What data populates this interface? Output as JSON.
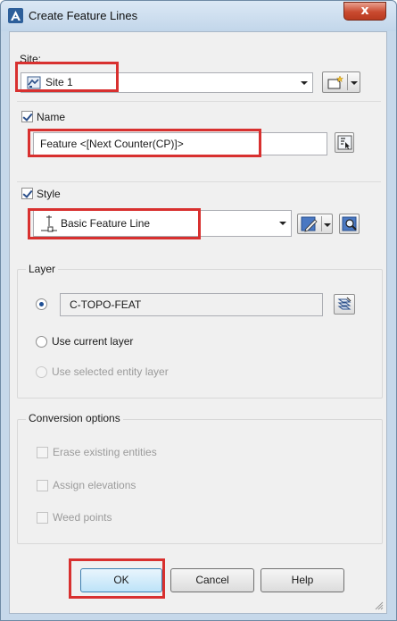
{
  "window": {
    "title": "Create Feature Lines",
    "close_glyph": "x",
    "app_icon": "autocad-a-icon",
    "accent": "#d8302f"
  },
  "site": {
    "label": "Site:",
    "value": "Site 1",
    "icon": "site-icon",
    "create_icon": "create-new-site-icon"
  },
  "name": {
    "label": "Name",
    "checked": true,
    "value": "Feature <[Next Counter(CP)]>",
    "edit_icon": "name-format-icon"
  },
  "style": {
    "label": "Style",
    "checked": true,
    "value": "Basic Feature Line",
    "icon": "feature-line-style-icon",
    "edit_icon": "edit-style-icon",
    "preview_icon": "preview-style-icon"
  },
  "layer": {
    "group_label": "Layer",
    "value": "C-TOPO-FEAT",
    "layer_icon": "layer-list-icon",
    "option_specified_selected": true,
    "option_current": "Use current layer",
    "option_selected_entity": "Use selected entity layer"
  },
  "conversion": {
    "group_label": "Conversion options",
    "erase": "Erase existing entities",
    "assign": "Assign elevations",
    "weed": "Weed points"
  },
  "buttons": {
    "ok": "OK",
    "cancel": "Cancel",
    "help": "Help"
  }
}
